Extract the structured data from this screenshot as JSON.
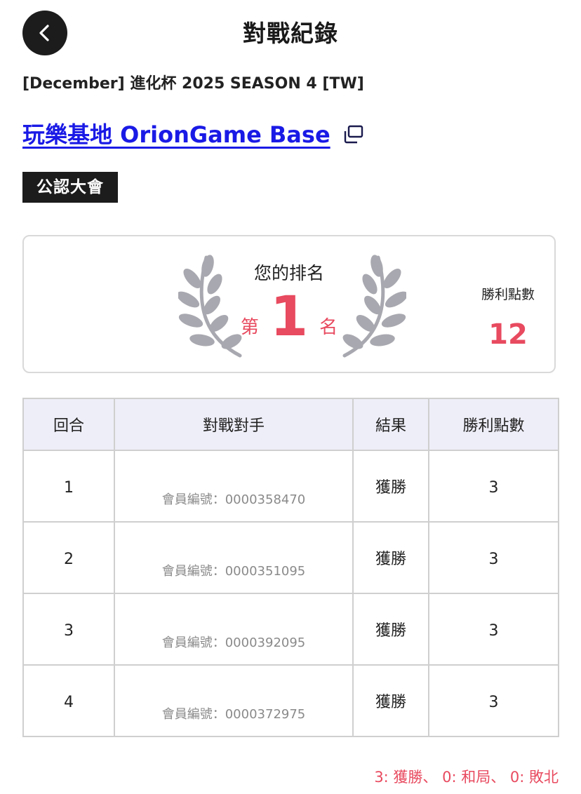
{
  "header": {
    "title": "對戰紀錄",
    "back_icon": "chevron-left-icon"
  },
  "event": {
    "name": "[December] 進化杯 2025 SEASON 4 [TW]",
    "store_name": "玩樂基地 OrionGame Base",
    "store_link_icon": "external-link-icon",
    "badge": "公認大會"
  },
  "ranking": {
    "label": "您的排名",
    "prefix": "第",
    "rank": "1",
    "suffix": "名",
    "points_label": "勝利點數",
    "points_value": "12",
    "wreath_icon": "laurel-wreath-icon"
  },
  "table": {
    "headers": [
      "回合",
      "對戰對手",
      "結果",
      "勝利點數"
    ],
    "rows": [
      {
        "round": "1",
        "opponent": "會員編號：0000358470",
        "result": "獲勝",
        "points": "3"
      },
      {
        "round": "2",
        "opponent": "會員編號：0000351095",
        "result": "獲勝",
        "points": "3"
      },
      {
        "round": "3",
        "opponent": "會員編號：0000392095",
        "result": "獲勝",
        "points": "3"
      },
      {
        "round": "4",
        "opponent": "會員編號：0000372975",
        "result": "獲勝",
        "points": "3"
      }
    ]
  },
  "legend": "3: 獲勝、 0: 和局、 0: 敗北",
  "colors": {
    "accent": "#e84a5f",
    "link": "#1a1ae6",
    "dark": "#1c1c1c",
    "table_header_bg": "#eeeef8"
  }
}
